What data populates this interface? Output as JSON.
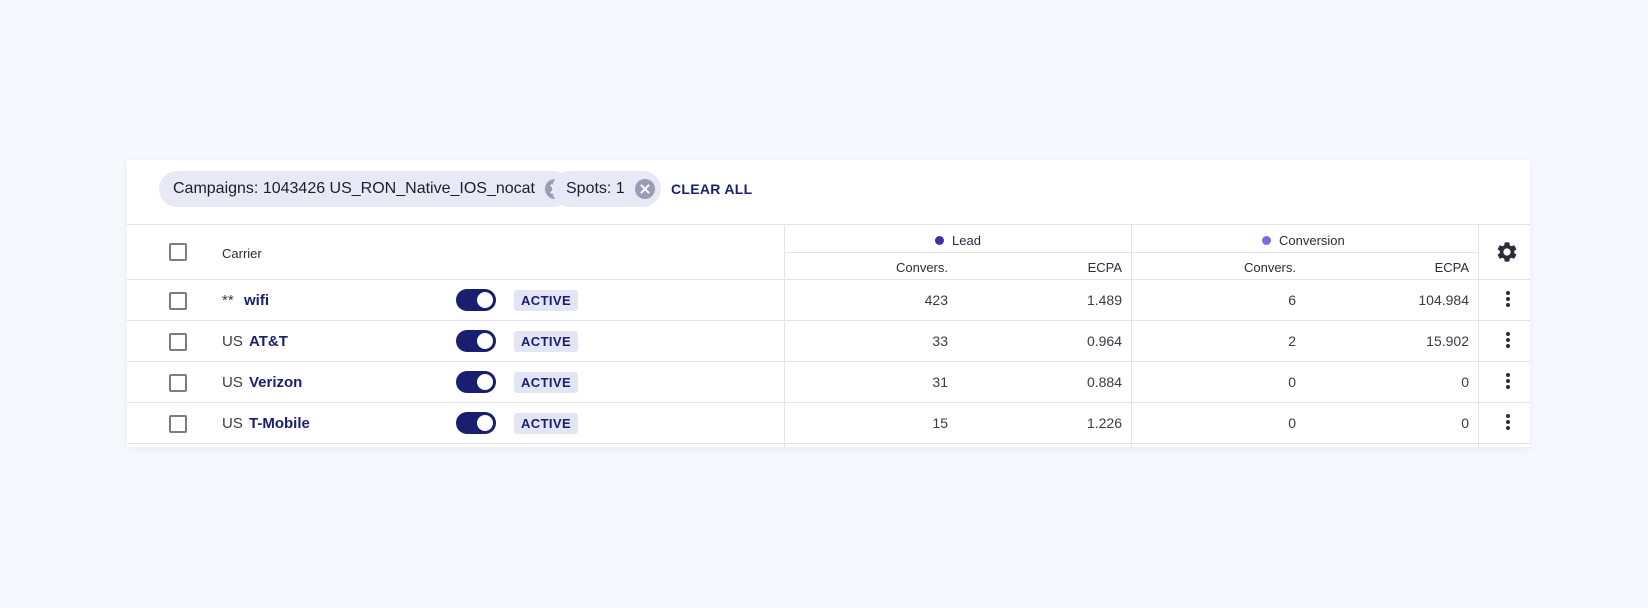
{
  "filters": {
    "chips": [
      {
        "label": "Campaigns: 1043426 US_RON_Native_IOS_nocat"
      },
      {
        "label": "Spots: 1"
      }
    ],
    "clear_all": "CLEAR ALL"
  },
  "table": {
    "carrier_header": "Carrier",
    "groups": [
      {
        "label": "Lead",
        "color": "#3d2fa8"
      },
      {
        "label": "Conversion",
        "color": "#7e6be0"
      }
    ],
    "subheaders": [
      "Convers.",
      "ECPA",
      "Convers.",
      "ECPA"
    ],
    "rows": [
      {
        "cc": "**",
        "carrier": "wifi",
        "status": "ACTIVE",
        "lead_convers": "423",
        "lead_ecpa": "1.489",
        "conv_convers": "6",
        "conv_ecpa": "104.984"
      },
      {
        "cc": "US",
        "carrier": "AT&T",
        "status": "ACTIVE",
        "lead_convers": "33",
        "lead_ecpa": "0.964",
        "conv_convers": "2",
        "conv_ecpa": "15.902"
      },
      {
        "cc": "US",
        "carrier": "Verizon",
        "status": "ACTIVE",
        "lead_convers": "31",
        "lead_ecpa": "0.884",
        "conv_convers": "0",
        "conv_ecpa": "0"
      },
      {
        "cc": "US",
        "carrier": "T-Mobile",
        "status": "ACTIVE",
        "lead_convers": "15",
        "lead_ecpa": "1.226",
        "conv_convers": "0",
        "conv_ecpa": "0"
      }
    ]
  }
}
